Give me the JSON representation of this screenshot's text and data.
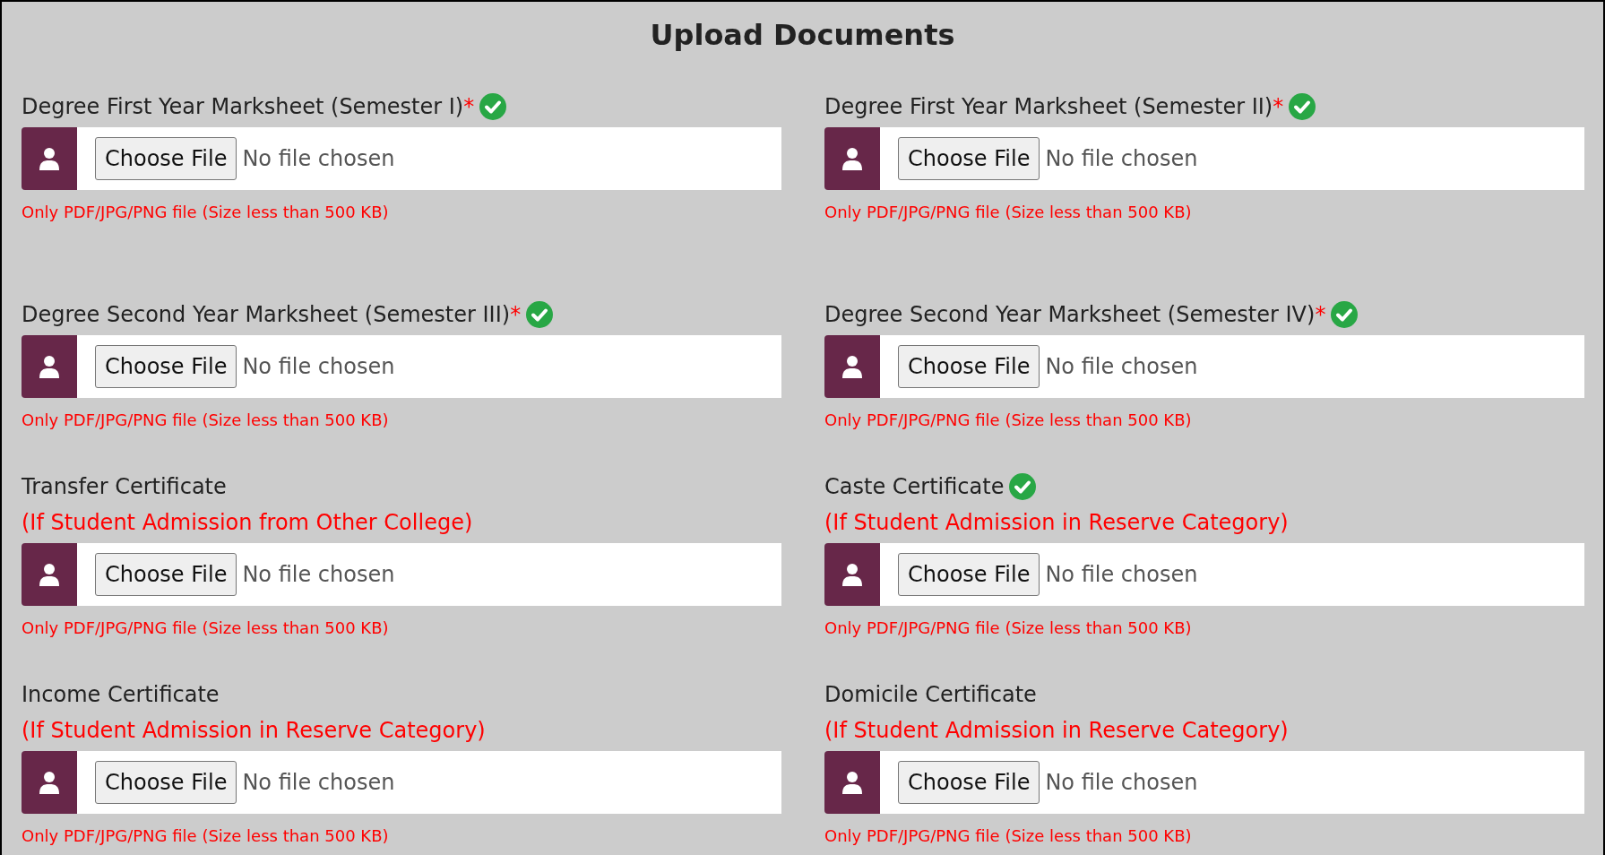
{
  "title": "Upload Documents",
  "fields": [
    {
      "label": "Degree First Year Marksheet (Semester I)",
      "required_mark": "*",
      "verified": true,
      "button": "Choose File",
      "status": "No file chosen",
      "hint": "Only PDF/JPG/PNG file (Size less than 500 KB)"
    },
    {
      "label": "Degree First Year Marksheet (Semester II)",
      "required_mark": "*",
      "verified": true,
      "button": "Choose File",
      "status": "No file chosen",
      "hint": "Only PDF/JPG/PNG file (Size less than 500 KB)"
    },
    {
      "label": "Degree Second Year Marksheet (Semester III)",
      "required_mark": "*",
      "verified": true,
      "button": "Choose File",
      "status": "No file chosen",
      "hint": "Only PDF/JPG/PNG file (Size less than 500 KB)"
    },
    {
      "label": "Degree Second Year Marksheet (Semester IV)",
      "required_mark": "*",
      "verified": true,
      "button": "Choose File",
      "status": "No file chosen",
      "hint": "Only PDF/JPG/PNG file (Size less than 500 KB)"
    },
    {
      "label": "Transfer Certificate",
      "verified": false,
      "note": "(If Student Admission from Other College)",
      "button": "Choose File",
      "status": "No file chosen",
      "hint": "Only PDF/JPG/PNG file (Size less than 500 KB)"
    },
    {
      "label": "Caste Certificate",
      "verified": true,
      "note": "(If Student Admission in Reserve Category)",
      "button": "Choose File",
      "status": "No file chosen",
      "hint": "Only PDF/JPG/PNG file (Size less than 500 KB)"
    },
    {
      "label": "Income Certificate",
      "verified": false,
      "note": "(If Student Admission in Reserve Category)",
      "button": "Choose File",
      "status": "No file chosen",
      "hint": "Only PDF/JPG/PNG file (Size less than 500 KB)"
    },
    {
      "label": "Domicile Certificate",
      "verified": false,
      "note": "(If Student Admission in Reserve Category)",
      "button": "Choose File",
      "status": "No file chosen",
      "hint": "Only PDF/JPG/PNG file (Size less than 500 KB)"
    }
  ]
}
